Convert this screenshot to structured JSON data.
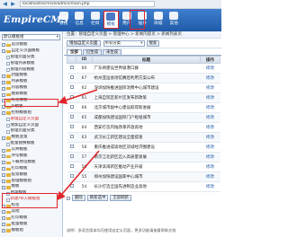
{
  "browser": {
    "url": "localhost/ecms/e/admin/main.php"
  },
  "header": {
    "logo": "EmpireCMS",
    "nav": [
      {
        "label": "系统",
        "icon": "system-icon"
      },
      {
        "label": "信息",
        "icon": "info-icon"
      },
      {
        "label": "栏目",
        "icon": "column-icon"
      },
      {
        "label": "模板",
        "icon": "template-icon",
        "active": true
      },
      {
        "label": "用户",
        "icon": "user-icon"
      },
      {
        "label": "插件",
        "icon": "plugin-icon"
      },
      {
        "label": "商城",
        "icon": "shop-icon"
      },
      {
        "label": "其他",
        "icon": "other-icon"
      }
    ]
  },
  "sidebar": {
    "select_value": "默认模板组",
    "items": [
      {
        "label": "首页模板",
        "type": "folder"
      },
      {
        "label": "自定义页面模板",
        "type": "folder"
      },
      {
        "label": "管理页面分类",
        "type": "doc"
      },
      {
        "label": "管理列表模板",
        "type": "doc"
      },
      {
        "label": "管理内容模板",
        "type": "doc"
      },
      {
        "label": "封面模板",
        "type": "folder"
      },
      {
        "label": "列表模板",
        "type": "folder"
      },
      {
        "label": "内容模板",
        "type": "folder"
      },
      {
        "label": "搜索模板",
        "type": "folder"
      },
      {
        "label": "标签模板",
        "type": "folder"
      },
      {
        "label": "JS模板",
        "type": "folder"
      },
      {
        "label": "控制模板组",
        "type": "folder"
      },
      {
        "label": "管理自定义页面",
        "type": "doc",
        "highlight": true
      },
      {
        "label": "增加自定义页面",
        "type": "doc"
      },
      {
        "label": "管理页面分类",
        "type": "doc"
      },
      {
        "label": "模板变量",
        "type": "folder"
      },
      {
        "label": "批量替换模板",
        "type": "doc"
      },
      {
        "label": "公共模板",
        "type": "folder"
      },
      {
        "label": "评论模板",
        "type": "folder"
      },
      {
        "label": "下载地址模板",
        "type": "folder"
      },
      {
        "label": "打印模板",
        "type": "folder"
      },
      {
        "label": "投票模板",
        "type": "folder"
      },
      {
        "label": "管理模板组",
        "type": "folder"
      },
      {
        "label": "模板",
        "type": "folder"
      },
      {
        "label": "管理模板",
        "type": "doc"
      },
      {
        "label": "新建/导入模板组",
        "type": "doc",
        "highlight": true
      },
      {
        "label": "标签",
        "type": "folder"
      },
      {
        "label": "其他",
        "type": "folder"
      },
      {
        "label": "打印模板",
        "type": "folder"
      },
      {
        "label": "批量模板",
        "type": "folder"
      },
      {
        "label": "模板组",
        "type": "folder"
      }
    ]
  },
  "main": {
    "breadcrumb": "位置：管理自定义页面 > 管理中心 > 新闻内容页 > 新闻列表页",
    "toolbar": {
      "add_label": "增加自定义页面",
      "select_value": "所有分类",
      "search_label": "搜索"
    },
    "tabs": [
      "全部",
      "已生成",
      "未生成"
    ],
    "table": {
      "headers": [
        "",
        "ID",
        "标题",
        "操作"
      ],
      "rows": [
        {
          "id": "60",
          "title": "广东将建设世界级港口群",
          "ops": "修改"
        },
        {
          "id": "67",
          "title": "杭州亚运会场馆赛后利用方案公布",
          "ops": "修改"
        },
        {
          "id": "62",
          "title": "深圳加快推进国际消费中心城市建设",
          "ops": "修改"
        },
        {
          "id": "61",
          "title": "上海自贸区新片区发布新政策",
          "ops": "修改"
        },
        {
          "id": "66",
          "title": "北京城市副中心建设取得新进展",
          "ops": "修改"
        },
        {
          "id": "65",
          "title": "成都加快建设国际门户枢纽城市",
          "ops": "修改"
        },
        {
          "id": "64",
          "title": "西安打造内陆改革开放高地",
          "ops": "修改"
        },
        {
          "id": "63",
          "title": "武汉长江新区建设全面提速",
          "ops": "修改"
        },
        {
          "id": "58",
          "title": "重庆推进成渝地区双城经济圈建设",
          "ops": "修改"
        },
        {
          "id": "57",
          "title": "南京江北新区迈入高质量发展",
          "ops": "修改"
        },
        {
          "id": "56",
          "title": "天津滨海新区推动产业升级",
          "ops": "修改"
        },
        {
          "id": "55",
          "title": "郑州加快建设国家中心城市",
          "ops": "修改"
        },
        {
          "id": "54",
          "title": "长沙打造全国先进制造业高地",
          "ops": "修改"
        }
      ]
    },
    "pager": {
      "buttons": [
        "删除",
        "刷新选中",
        "全部刷新"
      ]
    },
    "footnote": "说明：多语言版本均可使用自定义页面，更多功能请查看帮助文档"
  }
}
